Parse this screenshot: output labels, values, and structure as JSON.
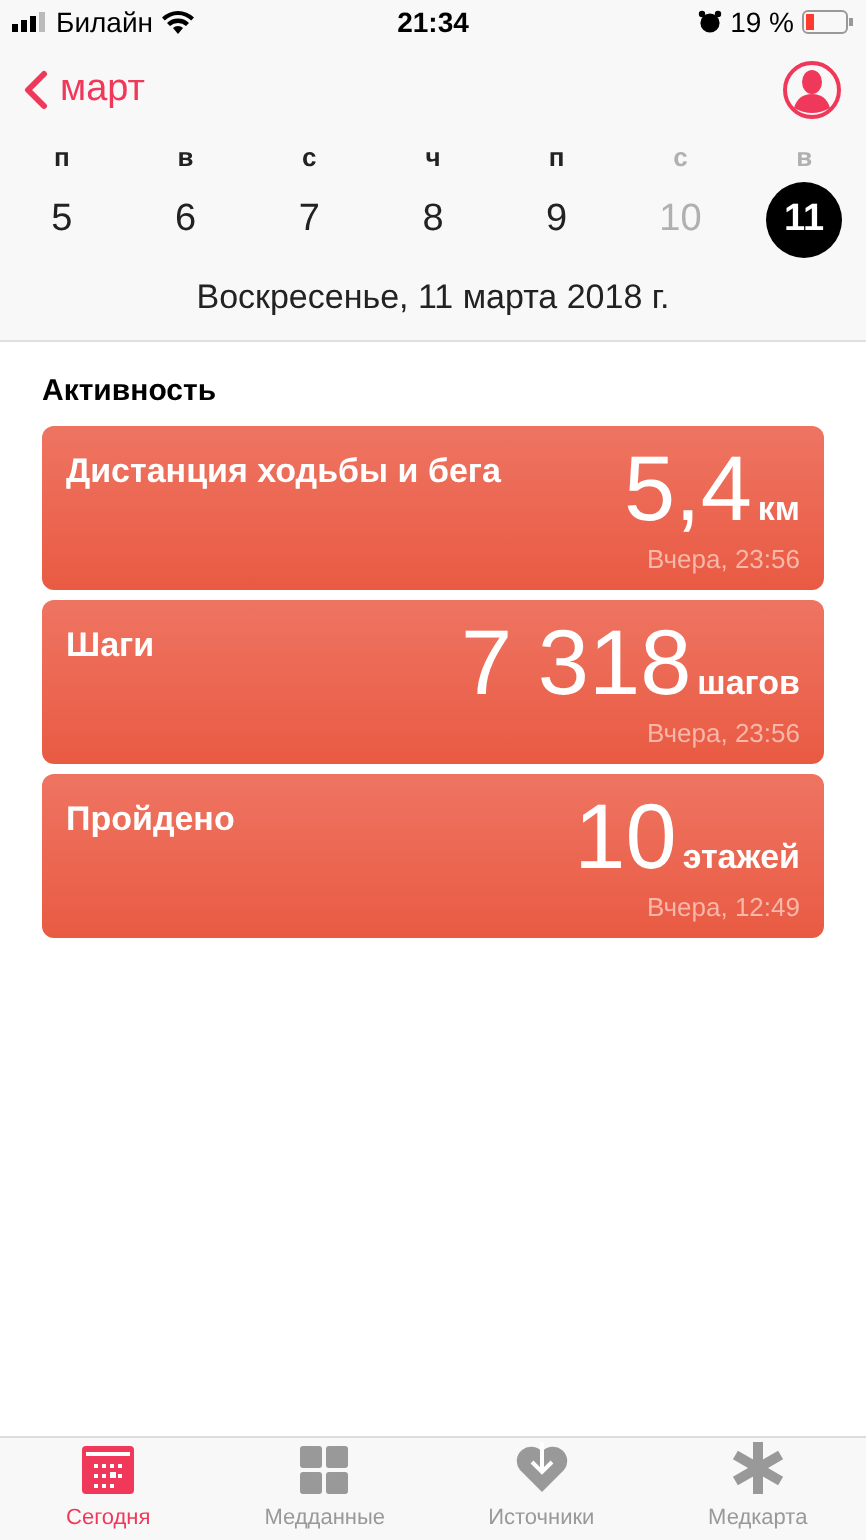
{
  "status_bar": {
    "carrier": "Билайн",
    "time": "21:34",
    "battery": "19 %"
  },
  "nav": {
    "back": "март"
  },
  "weekdays": [
    {
      "label": "п",
      "dimmed": false
    },
    {
      "label": "в",
      "dimmed": false
    },
    {
      "label": "с",
      "dimmed": false
    },
    {
      "label": "ч",
      "dimmed": false
    },
    {
      "label": "п",
      "dimmed": false
    },
    {
      "label": "с",
      "dimmed": true
    },
    {
      "label": "в",
      "dimmed": true
    }
  ],
  "days": [
    {
      "label": "5",
      "selected": false,
      "dimmed": false
    },
    {
      "label": "6",
      "selected": false,
      "dimmed": false
    },
    {
      "label": "7",
      "selected": false,
      "dimmed": false
    },
    {
      "label": "8",
      "selected": false,
      "dimmed": false
    },
    {
      "label": "9",
      "selected": false,
      "dimmed": false
    },
    {
      "label": "10",
      "selected": false,
      "dimmed": true
    },
    {
      "label": "11",
      "selected": true,
      "dimmed": false
    }
  ],
  "date_title": "Воскресенье, 11 марта 2018 г.",
  "section_title": "Активность",
  "cards": [
    {
      "title": "Дистанция ходьбы и бега",
      "value": "5,4",
      "unit": "км",
      "time": "Вчера, 23:56"
    },
    {
      "title": "Шаги",
      "value": "7 318",
      "unit": "шагов",
      "time": "Вчера, 23:56"
    },
    {
      "title": "Пройдено",
      "value": "10",
      "unit": "этажей",
      "time": "Вчера, 12:49"
    }
  ],
  "tabs": [
    {
      "label": "Сегодня",
      "kind": "calendar",
      "selected": true
    },
    {
      "label": "Медданные",
      "kind": "grid",
      "selected": false
    },
    {
      "label": "Источники",
      "kind": "heart",
      "selected": false
    },
    {
      "label": "Медкарта",
      "kind": "asterisk",
      "selected": false
    }
  ]
}
